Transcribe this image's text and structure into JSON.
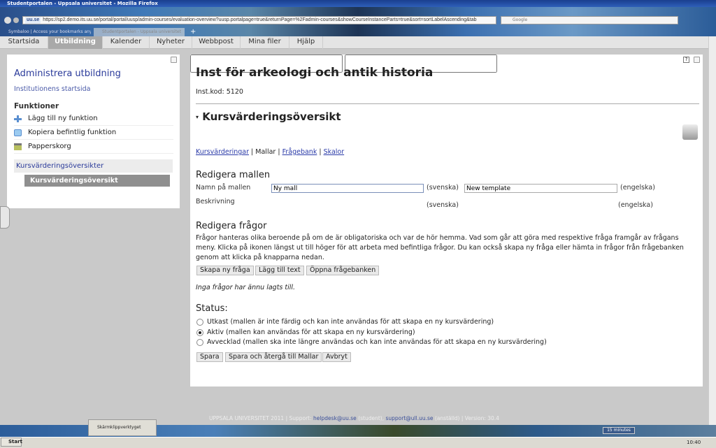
{
  "browser": {
    "window_title": "Studentportalen - Uppsala universitet - Mozilla Firefox",
    "url": "https://sp2.demo.its.uu.se/portal/portal/uusp/admin-courses/evaluation-overview?uusp.portalpage=true&returnPage=%2Fadmin-courses&showCourseInstanceParts=true&sort=sortLabelAscending&tab",
    "url_domain": "uu.se",
    "search_placeholder": "Google",
    "tabs": [
      "Symbaloo | Access your bookmarks anyw...",
      "Studentportalen - Uppsala universitet"
    ],
    "new_tab": "+"
  },
  "nav": {
    "tabs": [
      {
        "label": "Startsida"
      },
      {
        "label": "Utbildning",
        "active": true
      },
      {
        "label": "Kalender"
      },
      {
        "label": "Nyheter"
      },
      {
        "label": "Webbpost"
      },
      {
        "label": "Mina filer"
      },
      {
        "label": "Hjälp"
      }
    ]
  },
  "sidebar": {
    "title": "Administrera utbildning",
    "home_link": "Institutionens startsida",
    "functions_heading": "Funktioner",
    "functions": [
      {
        "label": "Lägg till ny funktion",
        "icon": "plus-icon"
      },
      {
        "label": "Kopiera befintlig funktion",
        "icon": "copy-icon"
      },
      {
        "label": "Papperskorg",
        "icon": "trash-icon"
      }
    ],
    "section": "Kursvärderingsöversikter",
    "selected": "Kursvärderingsöversikt"
  },
  "main": {
    "title": "Inst för arkeologi och antik historia",
    "inst_code": "Inst.kod: 5120",
    "help": "?",
    "section_title": "Kursvärderingsöversikt",
    "breadcrumb": {
      "links": [
        "Kursvärderingar",
        "Mallar",
        "Frågebank",
        "Skalor"
      ],
      "separator": "|"
    },
    "edit_template": {
      "heading": "Redigera mallen",
      "name_label": "Namn på mallen",
      "name_sv": "Ny mall",
      "name_en": "New template",
      "desc_label": "Beskrivning",
      "desc_sv": "",
      "desc_en": "",
      "sv": "(svenska)",
      "en": "(engelska)"
    },
    "edit_questions": {
      "heading": "Redigera frågor",
      "description": "Frågor hanteras olika beroende på om de är obligatoriska och var de hör hemma. Vad som går att göra med respektive fråga framgår av frågans meny. Klicka på ikonen längst ut till höger för att arbeta med befintliga frågor. Du kan också skapa ny fråga eller hämta in frågor från frågebanken genom att klicka på knapparna nedan.",
      "buttons": [
        "Skapa ny fråga",
        "Lägg till text",
        "Öppna frågebanken"
      ],
      "empty": "Inga frågor har ännu lagts till."
    },
    "status": {
      "heading": "Status:",
      "options": [
        {
          "label": "Utkast (mallen är inte färdig och kan inte användas för att skapa en ny kursvärdering)",
          "checked": false
        },
        {
          "label": "Aktiv (mallen kan användas för att skapa en ny kursvärdering)",
          "checked": true
        },
        {
          "label": "Avvecklad (mallen ska inte längre användas och kan inte användas för att skapa en ny kursvärdering)",
          "checked": false
        }
      ]
    },
    "actions": [
      "Spara",
      "Spara och återgå till Mallar",
      "Avbryt"
    ]
  },
  "footer": {
    "prefix": "UPPSALA UNIVERSITET 2011 | Support: ",
    "email1": "helpdesk@uu.se",
    "mid": " (student), ",
    "email2": "support@ull.uu.se",
    "suffix": " (anställd) | Version: 30.4"
  },
  "taskbar": {
    "start": "Start",
    "popup": "Skärmklippverktyget",
    "timer": "15 minutes",
    "clock": "10:40"
  }
}
